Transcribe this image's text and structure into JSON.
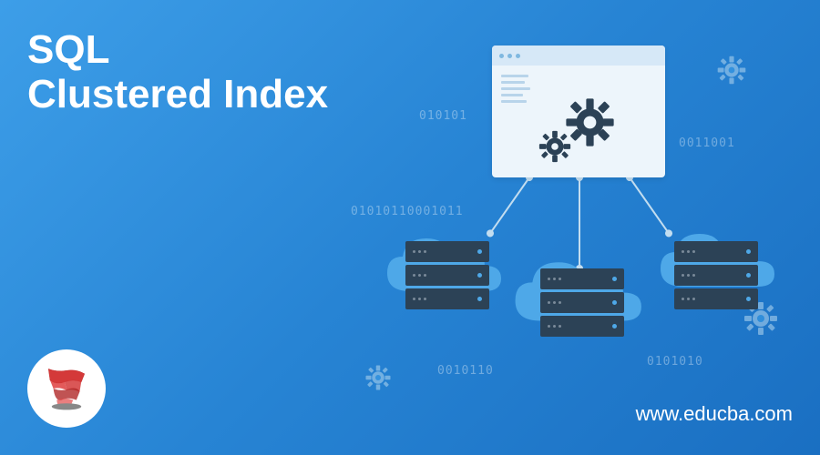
{
  "title_line1": "SQL",
  "title_line2": "Clustered Index",
  "website": "www.educba.com",
  "binary_strings": {
    "b1": "010101",
    "b2": "0011001",
    "b3": "01010110001011",
    "b4": "0101010",
    "b5": "0010110"
  }
}
